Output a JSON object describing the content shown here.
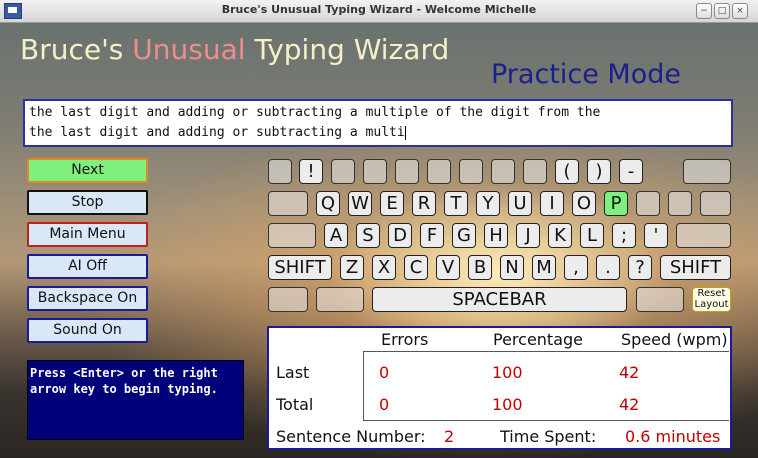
{
  "window": {
    "title": "Bruce's Unusual Typing Wizard - Welcome  Michelle"
  },
  "header": {
    "title_part1": "Bruce's ",
    "title_part2": "Unusual",
    "title_part3": " Typing Wizard",
    "mode": "Practice Mode"
  },
  "prompt": {
    "target_line": "the last digit and adding or subtracting a multiple of the digit from the",
    "typed_line": "the last digit and adding or subtracting a multi"
  },
  "buttons": {
    "next": "Next",
    "stop": "Stop",
    "main_menu": "Main Menu",
    "ai": "AI Off",
    "backspace": "Backspace On",
    "sound": "Sound On"
  },
  "info_text": "Press <Enter> or the right arrow key to begin typing.",
  "keyboard": {
    "row1": [
      "",
      "!",
      "",
      "",
      "",
      "",
      "",
      "",
      "",
      "(",
      ")",
      "-",
      ""
    ],
    "row2": [
      "",
      "Q",
      "W",
      "E",
      "R",
      "T",
      "Y",
      "U",
      "I",
      "O",
      "P",
      "",
      ""
    ],
    "row3": [
      "",
      "A",
      "S",
      "D",
      "F",
      "G",
      "H",
      "J",
      "K",
      "L",
      ";",
      "'",
      ""
    ],
    "row4": [
      "SHIFT",
      "Z",
      "X",
      "C",
      "V",
      "B",
      "N",
      "M",
      ",",
      ".",
      "?",
      "SHIFT"
    ],
    "spacebar": "SPACEBAR",
    "reset_layout": "Reset Layout",
    "highlighted_key": "P"
  },
  "stats": {
    "headers": {
      "errors": "Errors",
      "percentage": "Percentage",
      "speed": "Speed (wpm)"
    },
    "last": {
      "label": "Last",
      "errors": "0",
      "percentage": "100",
      "speed": "42"
    },
    "total": {
      "label": "Total",
      "errors": "0",
      "percentage": "100",
      "speed": "42"
    },
    "sentence_label": "Sentence Number:",
    "sentence_number": "2",
    "time_label": "Time Spent:",
    "time_value": "0.6 minutes"
  },
  "colors": {
    "accent_blue": "#1a1a9a",
    "next_green": "#7df07d",
    "value_red": "#c00000",
    "info_bg": "#00007a"
  }
}
